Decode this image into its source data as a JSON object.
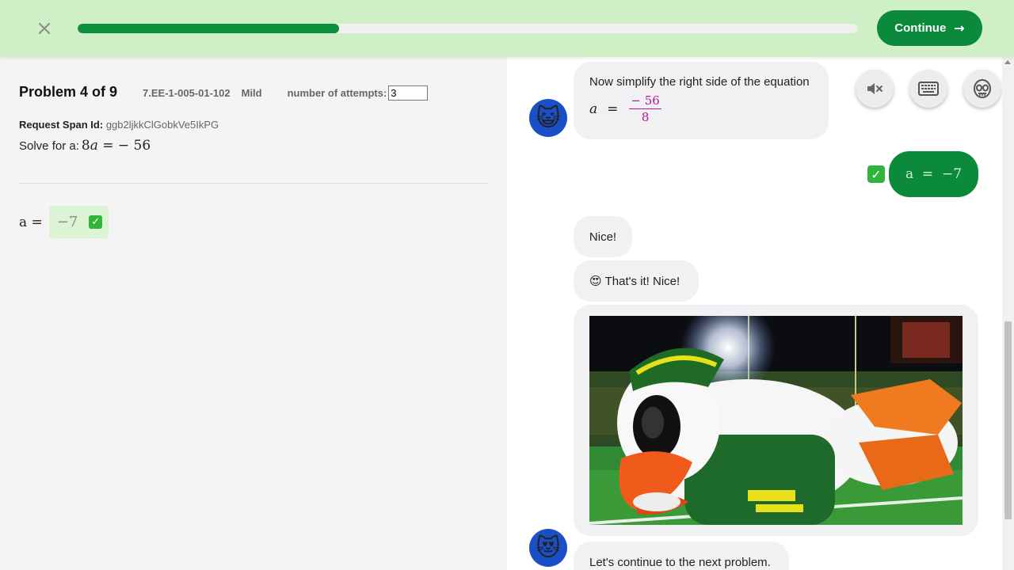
{
  "topbar": {
    "close_label": "×",
    "progress_percent": 33.5,
    "continue_label": "Continue",
    "continue_arrow": "→"
  },
  "problem": {
    "title": "Problem 4 of 9",
    "code": "7.EE-1-005-01-102",
    "level": "Mild",
    "attempts_label": "number of attempts:",
    "attempts_value": "3",
    "span_label": "Request Span Id:",
    "span_value": "ggb2ljkkClGobkVe5IkPG",
    "solve_prefix": "Solve for a:",
    "equation_coef": "8",
    "equation_var": "a",
    "equation_rest": " = − 56",
    "answer_lhs": "a =",
    "answer_value": "−7"
  },
  "chat": {
    "msg1_text": "Now simplify the right side of the equation",
    "msg1_lhs": "a",
    "msg1_eq": "=",
    "msg1_num": "− 56",
    "msg1_den": "8",
    "user_answer": "a  =  −7",
    "msg2_text": "Nice!",
    "msg3_emoji": "😍",
    "msg3_text": "That's it! Nice!",
    "msg5_text": "Let's continue to the next problem.",
    "avatar1_emoji": "😺",
    "avatar2_emoji": "😻"
  },
  "tools": [
    {
      "name": "mute-icon"
    },
    {
      "name": "keyboard-icon"
    },
    {
      "name": "alien-icon"
    }
  ],
  "colors": {
    "topbar_bg": "#cff0c6",
    "accent_green": "#0a8a3a",
    "fraction_magenta": "#b3179a",
    "avatar_blue": "#1a4fc8"
  }
}
